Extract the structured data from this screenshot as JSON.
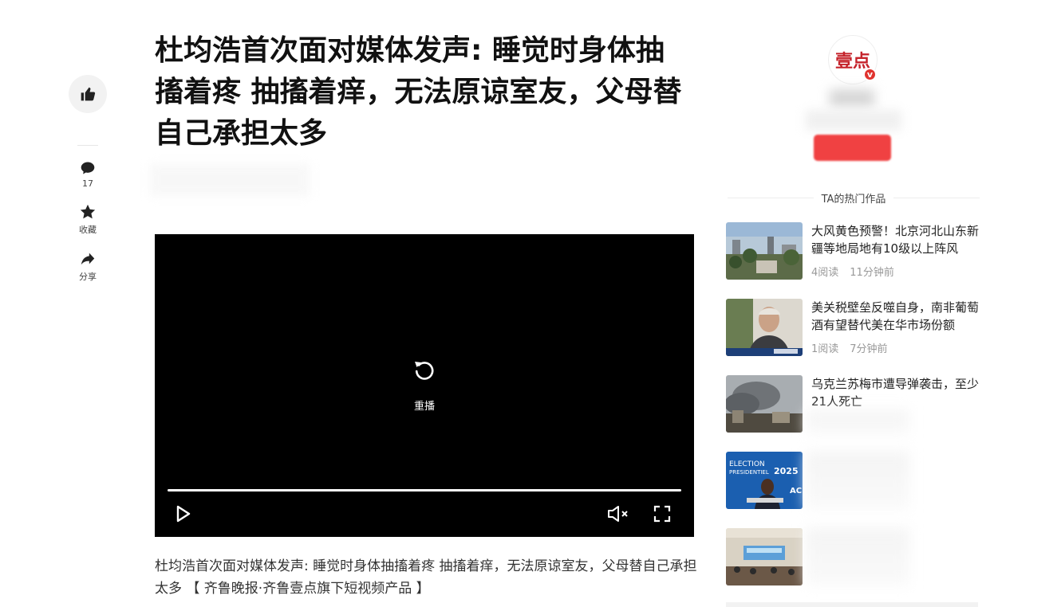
{
  "article": {
    "title": "杜均浩首次面对媒体发声: 睡觉时身体抽搐着疼 抽搐着痒，无法原谅室友，父母替自己承担太多",
    "caption": "杜均浩首次面对媒体发声: 睡觉时身体抽搐着疼 抽搐着痒，无法原谅室友，父母替自己承担太多 【 齐鲁晚报·齐鲁壹点旗下短视频产品 】"
  },
  "rail": {
    "comment_count": "17",
    "collect_label": "收藏",
    "share_label": "分享"
  },
  "player": {
    "replay_label": "重播",
    "progress": 1.0
  },
  "author": {
    "logo_text": "壹点",
    "verified_badge": "v"
  },
  "sidebar": {
    "section_title": "TA的热门作品",
    "items": [
      {
        "title": "大风黄色预警！北京河北山东新疆等地局地有10级以上阵风",
        "reads": "4阅读",
        "time": "11分钟前",
        "thumb": "city"
      },
      {
        "title": "美关税壁垒反噬自身，南非葡萄酒有望替代美在华市场份额",
        "reads": "1阅读",
        "time": "7分钟前",
        "thumb": "man"
      },
      {
        "title": "乌克兰苏梅市遭导弹袭击，至少21人死亡",
        "reads": "",
        "time": "",
        "thumb": "smoke"
      },
      {
        "title": "",
        "reads": "",
        "time": "",
        "thumb": "election",
        "thumb_text_1": "ELECTION",
        "thumb_text_2": "PRESIDENTIEL",
        "thumb_text_3": "2025",
        "thumb_text_4": "AC"
      },
      {
        "title": "",
        "reads": "",
        "time": "",
        "thumb": "conference"
      }
    ]
  },
  "colors": {
    "follow": "#f04142",
    "badge": "#e0332e",
    "player_bg": "#000000"
  }
}
